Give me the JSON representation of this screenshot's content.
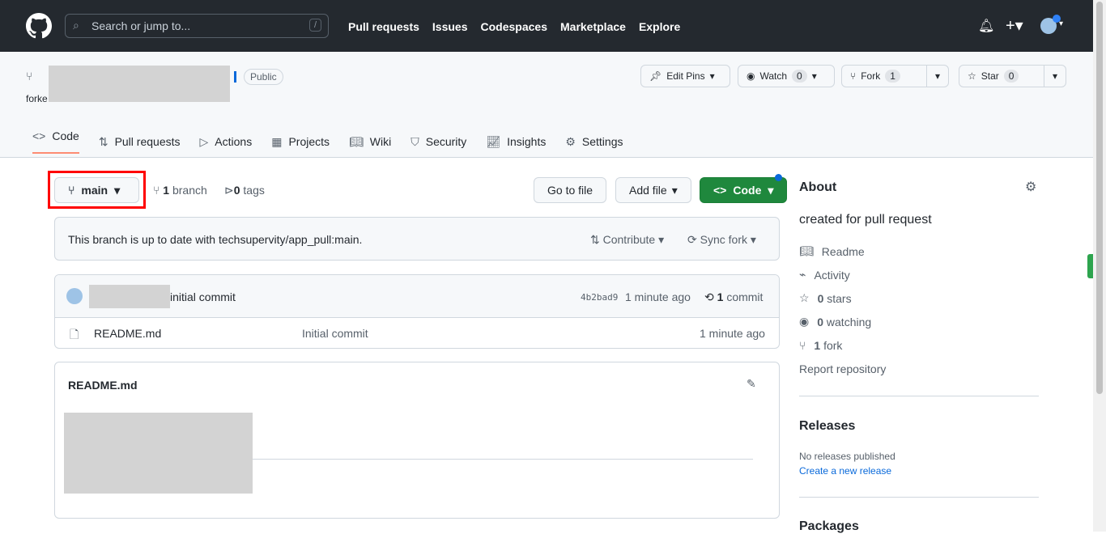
{
  "header": {
    "search_placeholder": "Search or jump to...",
    "search_shortcut": "/",
    "nav": [
      "Pull requests",
      "Issues",
      "Codespaces",
      "Marketplace",
      "Explore"
    ]
  },
  "repo": {
    "visibility": "Public",
    "forked_prefix": "forke",
    "edit_pins": "Edit Pins",
    "watch": "Watch",
    "watch_count": "0",
    "fork": "Fork",
    "fork_count": "1",
    "star": "Star",
    "star_count": "0"
  },
  "tabs": [
    "Code",
    "Pull requests",
    "Actions",
    "Projects",
    "Wiki",
    "Security",
    "Insights",
    "Settings"
  ],
  "branch": {
    "name": "main",
    "branch_count": "1",
    "branch_label": "branch",
    "tag_count": "0",
    "tag_label": "tags"
  },
  "buttons": {
    "go_to_file": "Go to file",
    "add_file": "Add file",
    "code": "Code"
  },
  "sync": {
    "message": "This branch is up to date with techsupervity/app_pull:main.",
    "contribute": "Contribute",
    "sync_fork": "Sync fork"
  },
  "commit": {
    "message": "initial commit",
    "sha": "4b2bad9",
    "time": "1 minute ago",
    "count": "1",
    "count_label": "commit"
  },
  "files": [
    {
      "name": "README.md",
      "message": "Initial commit",
      "time": "1 minute ago"
    }
  ],
  "readme": {
    "title": "README.md"
  },
  "about": {
    "title": "About",
    "description": "created for pull request",
    "readme": "Readme",
    "activity": "Activity",
    "stars": "0",
    "stars_label": "stars",
    "watching": "0",
    "watching_label": "watching",
    "forks": "1",
    "forks_label": "fork",
    "report": "Report repository"
  },
  "releases": {
    "title": "Releases",
    "none": "No releases published",
    "create": "Create a new release"
  },
  "packages": {
    "title": "Packages"
  },
  "colors": {
    "header_bg": "#24292f",
    "primary_green": "#1f883d",
    "link": "#0969da",
    "highlight_red": "#ff0000"
  }
}
